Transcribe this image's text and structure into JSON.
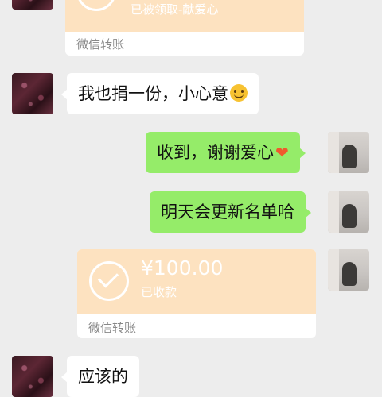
{
  "messages": {
    "card1": {
      "status": "已被领取-献爱心",
      "label": "微信转账"
    },
    "msg_donate": {
      "text": "我也捐一份，小心意",
      "emoji": "smiling-face"
    },
    "msg_thanks": {
      "text": "收到，谢谢爱心",
      "emoji": "heart"
    },
    "msg_update": {
      "text": "明天会更新名单哈"
    },
    "card2": {
      "amount": "¥100.00",
      "status": "已收款",
      "label": "微信转账"
    },
    "msg_reply": {
      "text": "应该的"
    }
  },
  "colors": {
    "background": "#ededed",
    "green_bubble": "#95ec69",
    "transfer_card": "#fde2c0"
  }
}
